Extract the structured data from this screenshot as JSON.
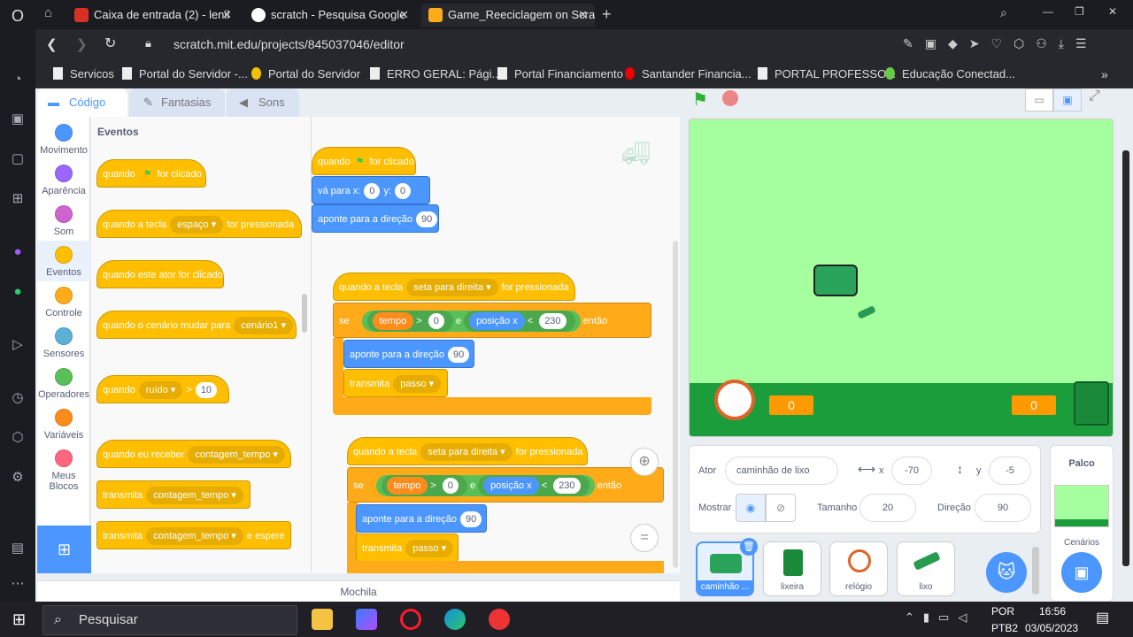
{
  "tabs": [
    {
      "title": "Caixa de entrada (2) - lenil",
      "color": "#d93025"
    },
    {
      "title": "scratch - Pesquisa Google",
      "color": "#4285f4"
    },
    {
      "title": "Game_Reeciclagem on Scra",
      "color": "#ffab19"
    }
  ],
  "address": {
    "url": "scratch.mit.edu/projects/845037046/editor"
  },
  "bookmarks": [
    "Servicos",
    "Portal do Servidor -...",
    "Portal do Servidor",
    "ERRO GERAL:  Pági...",
    "Portal Financiamento",
    "Santander Financia...",
    "PORTAL PROFESSO...",
    "Educação Conectad..."
  ],
  "editor_tabs": {
    "code": "Código",
    "costumes": "Fantasias",
    "sounds": "Sons"
  },
  "categories": [
    {
      "label": "Movimento",
      "color": "#4c97ff"
    },
    {
      "label": "Aparência",
      "color": "#9966ff"
    },
    {
      "label": "Som",
      "color": "#cf63cf"
    },
    {
      "label": "Eventos",
      "color": "#ffbf00"
    },
    {
      "label": "Controle",
      "color": "#ffab19"
    },
    {
      "label": "Sensores",
      "color": "#5cb1d6"
    },
    {
      "label": "Operadores",
      "color": "#59c059"
    },
    {
      "label": "Variáveis",
      "color": "#ff8c1a"
    },
    {
      "label": "Meus Blocos",
      "color": "#ff6680"
    }
  ],
  "palette": {
    "heading": "Eventos",
    "b1": {
      "a": "quando",
      "b": "for clicado"
    },
    "b2": {
      "a": "quando a tecla",
      "key": "espaço",
      "b": "for pressionada"
    },
    "b3": "quando este ator for clicado",
    "b4": {
      "a": "quando o cenário mudar para",
      "v": "cenário1"
    },
    "b5": {
      "a": "quando",
      "v": "ruído",
      "op": ">",
      "n": "10"
    },
    "b6": {
      "a": "quando eu receber",
      "v": "contagem_tempo"
    },
    "b7": {
      "a": "transmita",
      "v": "contagem_tempo"
    },
    "b8": {
      "a": "transmita",
      "v": "contagem_tempo",
      "b": "e espere"
    }
  },
  "script1": {
    "hat_a": "quando",
    "hat_b": "for clicado",
    "goto": "vá para x:",
    "x": "0",
    "y_lbl": "y:",
    "y": "0",
    "point": "aponte para a direção",
    "dir": "90"
  },
  "script2": {
    "hat": "quando a tecla",
    "key": "seta para direita",
    "hat_b": "for pressionada",
    "if": "se",
    "var": "tempo",
    "gt": ">",
    "zero": "0",
    "and": "e",
    "pos": "posição x",
    "lt": "<",
    "lim": "230",
    "then": "então",
    "point": "aponte para a direção",
    "dir": "90",
    "bcast": "transmita",
    "msg": "passo"
  },
  "script3": {
    "hat": "quando a tecla",
    "key": "seta para direita",
    "hat_b": "for pressionada",
    "if": "se",
    "var": "tempo",
    "gt": ">",
    "zero": "0",
    "and": "e",
    "pos": "posição x",
    "lt": "<",
    "lim": "230",
    "then": "então",
    "point": "aponte para a direção",
    "dir": "90",
    "bcast": "transmita",
    "msg": "passo"
  },
  "zoom_reset": "=",
  "backpack": "Mochila",
  "stage": {
    "left_counter": "0",
    "right_counter": "0"
  },
  "sprite": {
    "actor_lbl": "Ator",
    "name": "caminhão de lixo",
    "x_lbl": "x",
    "x": "-70",
    "y_lbl": "y",
    "y": "-5",
    "show_lbl": "Mostrar",
    "size_lbl": "Tamanho",
    "size": "20",
    "dir_lbl": "Direção",
    "dir": "90"
  },
  "sprites": [
    "caminhão ...",
    "lixeira",
    "relógio",
    "lixo"
  ],
  "stage_pane": {
    "title": "Palco",
    "backdrops": "Cenários"
  },
  "taskbar": {
    "search": "Pesquisar",
    "lang1": "POR",
    "lang2": "PTB2",
    "time": "16:56",
    "date": "03/05/2023"
  }
}
